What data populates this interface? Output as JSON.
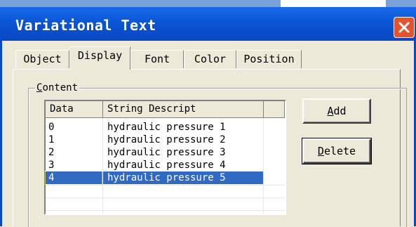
{
  "window": {
    "title": "Variational Text"
  },
  "tabs": [
    {
      "label": "Object"
    },
    {
      "label": "Display"
    },
    {
      "label": "Font"
    },
    {
      "label": "Color"
    },
    {
      "label": "Position"
    }
  ],
  "active_tab": "Display",
  "content_group": {
    "label_first": "C",
    "label_rest": "ontent"
  },
  "list": {
    "columns": [
      "Data",
      "String Descript"
    ],
    "rows": [
      {
        "data": "0",
        "desc": "hydraulic pressure 1"
      },
      {
        "data": "1",
        "desc": "hydraulic pressure 2"
      },
      {
        "data": "2",
        "desc": "hydraulic pressure 3"
      },
      {
        "data": "3",
        "desc": "hydraulic pressure 4"
      },
      {
        "data": "4",
        "desc": "hydraulic pressure 5"
      }
    ],
    "selected_row": 4
  },
  "buttons": {
    "add": {
      "mnemonic": "A",
      "rest": "dd"
    },
    "delete": {
      "mnemonic": "D",
      "rest": "elete"
    }
  },
  "icons": {
    "close": "close-icon"
  },
  "colors": {
    "titlebar": "#0a54d4",
    "selection": "#316ac5",
    "close": "#e2532e",
    "face": "#ece9d8"
  }
}
